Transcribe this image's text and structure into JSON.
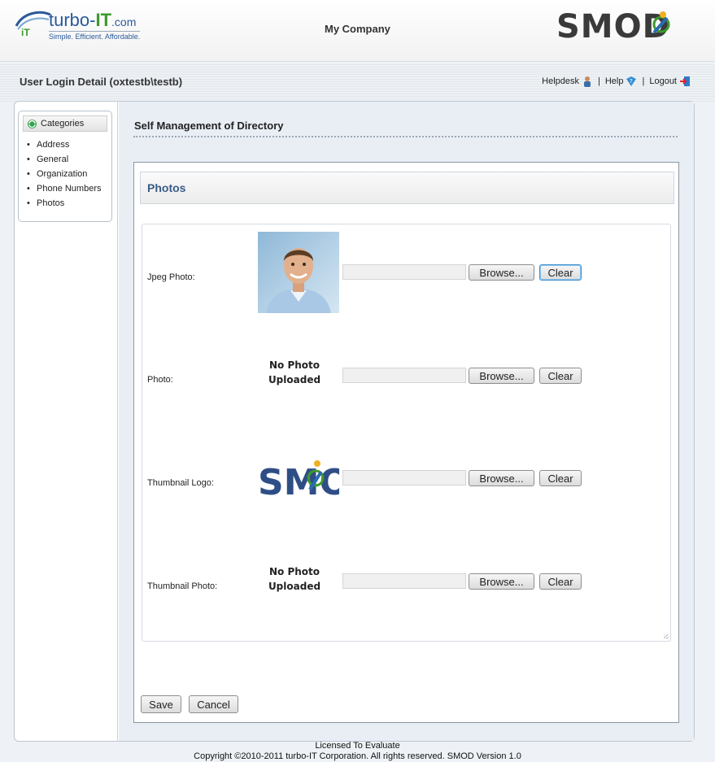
{
  "header": {
    "left_logo_brand": "turbo-",
    "left_logo_brand_strong": "IT",
    "left_logo_suffix": ".com",
    "left_logo_tagline": "Simple.  Efficient.  Affordable.",
    "company": "My Company",
    "right_logo_text": "SMOD"
  },
  "subheader": {
    "user_detail": "User Login Detail (oxtestb\\testb)",
    "links": {
      "helpdesk": "Helpdesk",
      "help": "Help",
      "logout": "Logout",
      "separator": "|"
    }
  },
  "sidebar": {
    "title": "Categories",
    "items": [
      "Address",
      "General",
      "Organization",
      "Phone Numbers",
      "Photos"
    ]
  },
  "main": {
    "page_title": "Self Management of Directory",
    "section_title": "Photos",
    "rows": [
      {
        "label": "Jpeg Photo:",
        "image": "person-photo"
      },
      {
        "label": "Photo:",
        "no_photo_line1": "No Photo",
        "no_photo_line2": "Uploaded"
      },
      {
        "label": "Thumbnail Logo:",
        "image": "smod-logo"
      },
      {
        "label": "Thumbnail Photo:",
        "no_photo_line1": "No Photo",
        "no_photo_line2": "Uploaded"
      }
    ],
    "browse_label": "Browse...",
    "clear_label": "Clear",
    "save_label": "Save",
    "cancel_label": "Cancel"
  },
  "footer": {
    "line1": "Licensed To Evaluate",
    "line2": "Copyright ©2010-2011 turbo-IT Corporation. All rights reserved. SMOD Version 1.0"
  },
  "colors": {
    "section_title": "#3a5c86",
    "brand_blue": "#2a5a9a",
    "brand_green": "#3c9a2a",
    "smod_dark": "#3a3a3a"
  }
}
